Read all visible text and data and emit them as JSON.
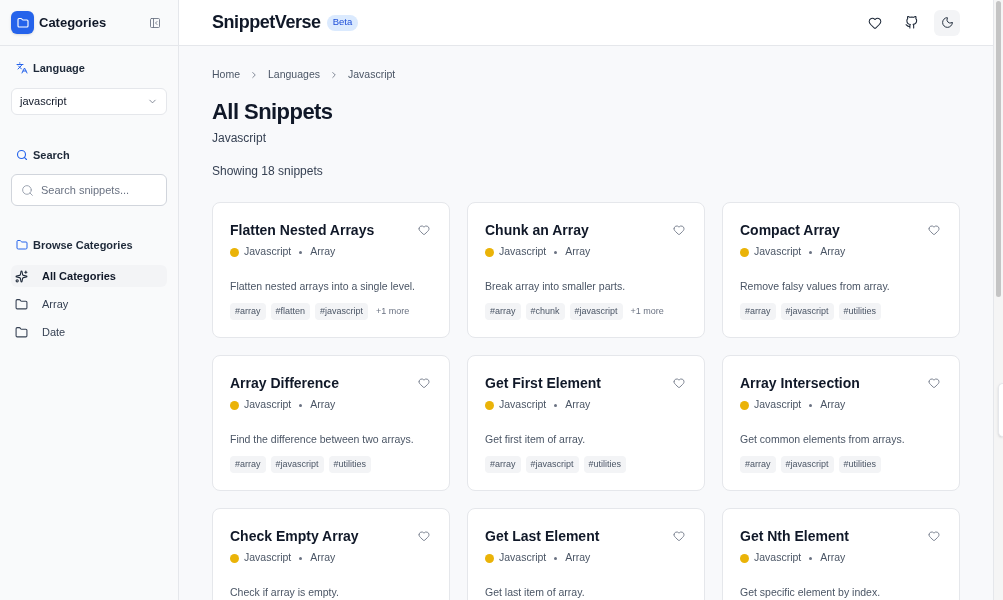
{
  "sidebar": {
    "title": "Categories",
    "language": {
      "label": "Language",
      "value": "javascript"
    },
    "search": {
      "label": "Search",
      "placeholder": "Search snippets..."
    },
    "browse": {
      "label": "Browse Categories",
      "items": [
        {
          "label": "All Categories",
          "kind": "all",
          "selected": true
        },
        {
          "label": "Array",
          "kind": "folder",
          "selected": false
        },
        {
          "label": "Date",
          "kind": "folder",
          "selected": false
        }
      ]
    }
  },
  "header": {
    "brand": "SnippetVerse",
    "badge": "Beta"
  },
  "breadcrumb": [
    "Home",
    "Languages",
    "Javascript"
  ],
  "page": {
    "title": "All Snippets",
    "subtitle": "Javascript",
    "count": "Showing 18 snippets"
  },
  "snippets": [
    {
      "title": "Flatten Nested Arrays",
      "language": "Javascript",
      "color": "#eab308",
      "category": "Array",
      "description": "Flatten nested arrays into a single level.",
      "tags": [
        "#array",
        "#flatten",
        "#javascript"
      ],
      "more": "+1 more"
    },
    {
      "title": "Chunk an Array",
      "language": "Javascript",
      "color": "#eab308",
      "category": "Array",
      "description": "Break array into smaller parts.",
      "tags": [
        "#array",
        "#chunk",
        "#javascript"
      ],
      "more": "+1 more"
    },
    {
      "title": "Compact Array",
      "language": "Javascript",
      "color": "#eab308",
      "category": "Array",
      "description": "Remove falsy values from array.",
      "tags": [
        "#array",
        "#javascript",
        "#utilities"
      ]
    },
    {
      "title": "Array Difference",
      "language": "Javascript",
      "color": "#eab308",
      "category": "Array",
      "description": "Find the difference between two arrays.",
      "tags": [
        "#array",
        "#javascript",
        "#utilities"
      ]
    },
    {
      "title": "Get First Element",
      "language": "Javascript",
      "color": "#eab308",
      "category": "Array",
      "description": "Get first item of array.",
      "tags": [
        "#array",
        "#javascript",
        "#utilities"
      ]
    },
    {
      "title": "Array Intersection",
      "language": "Javascript",
      "color": "#eab308",
      "category": "Array",
      "description": "Get common elements from arrays.",
      "tags": [
        "#array",
        "#javascript",
        "#utilities"
      ]
    },
    {
      "title": "Check Empty Array",
      "language": "Javascript",
      "color": "#eab308",
      "category": "Array",
      "description": "Check if array is empty."
    },
    {
      "title": "Get Last Element",
      "language": "Javascript",
      "color": "#eab308",
      "category": "Array",
      "description": "Get last item of array."
    },
    {
      "title": "Get Nth Element",
      "language": "Javascript",
      "color": "#eab308",
      "category": "Array",
      "description": "Get specific element by index."
    }
  ]
}
